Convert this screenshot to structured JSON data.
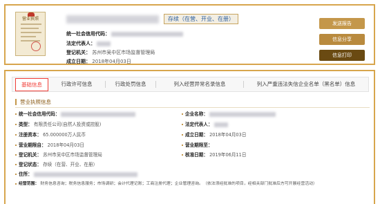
{
  "license_thumbnail": {
    "title": "营业执照"
  },
  "header": {
    "status_badge": "存续（在营、开业、在册）",
    "fields": [
      {
        "label": "统一社会信用代码：",
        "value": ""
      },
      {
        "label": "法定代表人：",
        "value": ""
      },
      {
        "label": "登记机关：",
        "value": "苏州市吴中区市场监督管理局"
      },
      {
        "label": "成立日期：",
        "value": "2018年04月03日"
      }
    ]
  },
  "actions": {
    "report": "发送报告",
    "share": "信息分享",
    "print": "信息打印"
  },
  "tabs": [
    {
      "label": "基础信息",
      "active": true
    },
    {
      "label": "行政许可信息",
      "active": false
    },
    {
      "label": "行政处罚信息",
      "active": false
    },
    {
      "label": "列入经营异常名录信息",
      "active": false
    },
    {
      "label": "列入严重违法失信企业名单（黑名单）信息",
      "active": false
    }
  ],
  "section": {
    "title": "营业执照信息",
    "left": [
      {
        "label": "统一社会信用代码：",
        "value": ""
      },
      {
        "label": "类型：",
        "value": "有限责任公司(自然人投资或控股)"
      },
      {
        "label": "注册资本：",
        "value": "65.000000万人民币"
      },
      {
        "label": "营业期限自：",
        "value": "2018年04月03日"
      },
      {
        "label": "登记机关：",
        "value": "苏州市吴中区市场监督管理局"
      },
      {
        "label": "登记状态：",
        "value": "存续（在营、开业、在册）"
      },
      {
        "label": "住所：",
        "value": ""
      },
      {
        "label": "经营范围：",
        "value": "财务信息咨询；税务信息服务；市场调研；会计代理记账；工商注册代理；企业管理咨询。（依法须经批准的项目，经相关部门批准后方可开展经营活动）"
      }
    ],
    "right": [
      {
        "label": "企业名称：",
        "value": ""
      },
      {
        "label": "法定代表人：",
        "value": ""
      },
      {
        "label": "成立日期：",
        "value": "2018年04月03日"
      },
      {
        "label": "营业期限至：",
        "value": ""
      },
      {
        "label": "核准日期：",
        "value": "2019年06月11日"
      }
    ]
  },
  "colors": {
    "accent_gold": "#d7a54c",
    "active_tab_red": "#f03c36",
    "print_button_brown": "#6a4a12",
    "status_blue": "#2a5d9f"
  }
}
